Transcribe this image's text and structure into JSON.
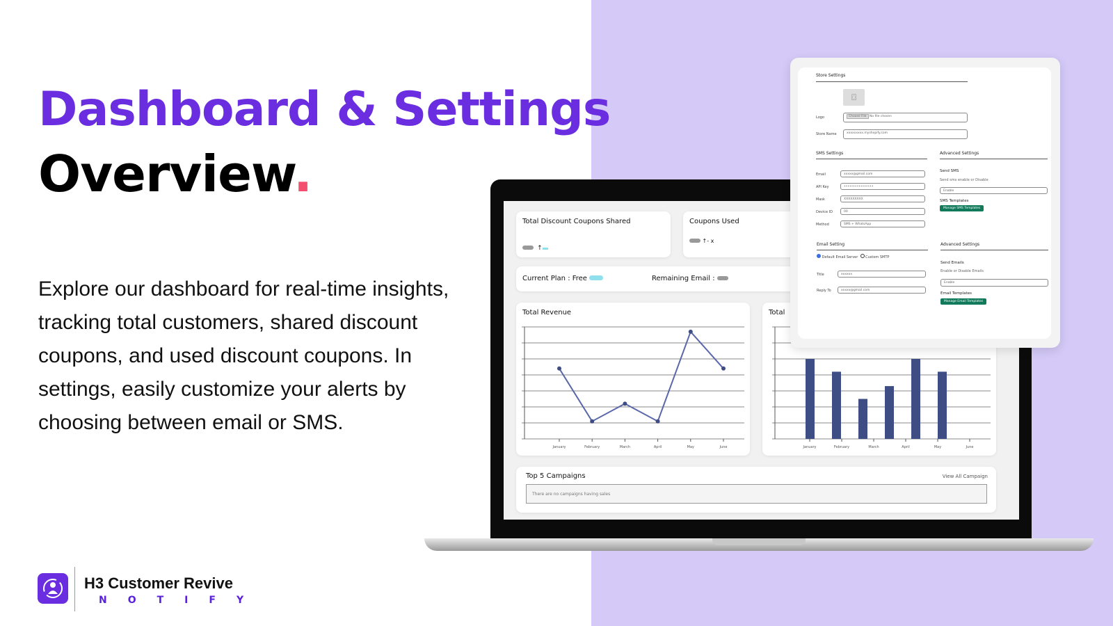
{
  "hero": {
    "title_line1": "Dashboard & Settings",
    "title_line2": "Overview",
    "title_dot": ".",
    "description": "Explore our dashboard for real-time insights, tracking total customers, shared discount coupons, and used discount coupons. In settings, easily customize your alerts by choosing between email or SMS."
  },
  "brand": {
    "name": "H3 Customer Revive",
    "sub": "NOTIFY",
    "logo_icon": "customer-bell-refresh-icon"
  },
  "colors": {
    "accent": "#6a2ee0",
    "dot": "#f2506e",
    "background_right": "#d4c9f7",
    "chart": "#3f4d85",
    "button_green": "#107a5a"
  },
  "dashboard": {
    "card1_title": "Total Discount Coupons Shared",
    "card2_title": "Coupons Used",
    "card2_value": "↑- x",
    "plan_label": "Current Plan : Free",
    "remaining_label": "Remaining Email :",
    "campaigns_title": "Top 5 Campaigns",
    "campaigns_link": "View All Campaign",
    "campaigns_empty": "There are no campaigns having sales"
  },
  "chart_data": [
    {
      "type": "line",
      "title": "Total Revenue",
      "categories": [
        "January",
        "February",
        "March",
        "April",
        "May",
        "June"
      ],
      "values": [
        4.4,
        1.1,
        2.2,
        1.1,
        6.7,
        4.4
      ],
      "ylim": [
        0,
        7
      ],
      "grid": true
    },
    {
      "type": "bar",
      "title": "Total",
      "categories": [
        "January",
        "February",
        "March",
        "April",
        "May",
        "June"
      ],
      "values": [
        5,
        4.2,
        2.5,
        3.3,
        5,
        4.2
      ],
      "ylim": [
        0,
        7
      ],
      "grid": true
    }
  ],
  "settings": {
    "store_title": "Store Settings",
    "logo_label": "Logo",
    "choose_file": "Choose File",
    "no_file": "No file chosen",
    "store_name_label": "Store Name",
    "store_name_value": "xxxxxxxxx.myshopify.com",
    "sms_title": "SMS Settings",
    "sms_fields": [
      {
        "label": "Email",
        "value": "xxxxx@gmail.com"
      },
      {
        "label": "API Key",
        "value": "••••••••••••••••"
      },
      {
        "label": "Mask",
        "value": "XXXXXXXXX"
      },
      {
        "label": "Device ID",
        "value": "00"
      },
      {
        "label": "Method",
        "value": "SMS + WhatsApp"
      }
    ],
    "adv_title": "Advanced Settings",
    "send_sms": "Send SMS",
    "send_sms_desc": "Send sms enable or Disable",
    "sms_select": "Enable",
    "sms_templates": "SMS Templates",
    "sms_btn": "Manage SMS Templates",
    "email_title": "Email Setting",
    "radio1": "Default Email Server",
    "radio2": "Custom SMTP",
    "email_fields": [
      {
        "label": "Title",
        "value": "xxxxxx"
      },
      {
        "label": "Reply To",
        "value": "xxxxx@gmail.com"
      }
    ],
    "adv2_title": "Advanced Settings",
    "send_emails": "Send Emails",
    "send_emails_desc": "Enable or Disable Emails",
    "email_select": "Enable",
    "email_templates": "Email Templates",
    "email_btn": "Manage Email Templates"
  }
}
